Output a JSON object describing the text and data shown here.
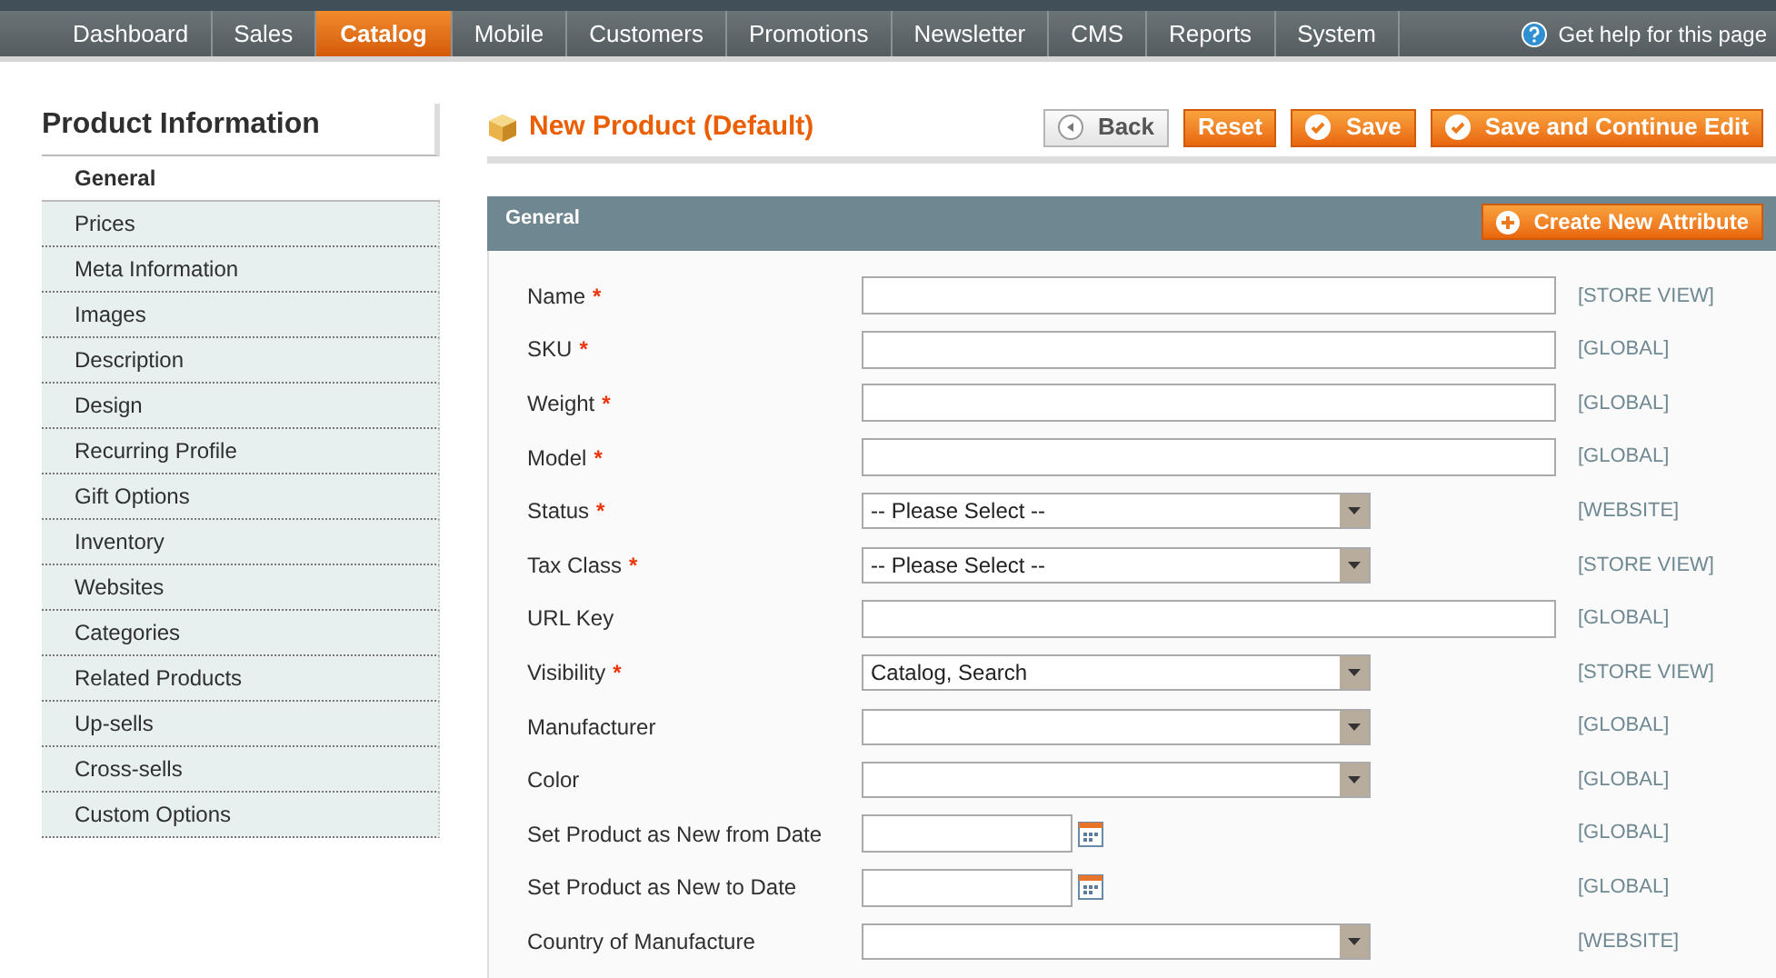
{
  "nav": {
    "tabs": [
      {
        "label": "Dashboard",
        "selected": false
      },
      {
        "label": "Sales",
        "selected": false
      },
      {
        "label": "Catalog",
        "selected": true
      },
      {
        "label": "Mobile",
        "selected": false
      },
      {
        "label": "Customers",
        "selected": false
      },
      {
        "label": "Promotions",
        "selected": false
      },
      {
        "label": "Newsletter",
        "selected": false
      },
      {
        "label": "CMS",
        "selected": false
      },
      {
        "label": "Reports",
        "selected": false
      },
      {
        "label": "System",
        "selected": false
      }
    ],
    "help": "Get help for this page"
  },
  "sidebar": {
    "title": "Product Information",
    "items": [
      {
        "label": "General",
        "selected": true
      },
      {
        "label": "Prices",
        "selected": false
      },
      {
        "label": "Meta Information",
        "selected": false
      },
      {
        "label": "Images",
        "selected": false
      },
      {
        "label": "Description",
        "selected": false
      },
      {
        "label": "Design",
        "selected": false
      },
      {
        "label": "Recurring Profile",
        "selected": false
      },
      {
        "label": "Gift Options",
        "selected": false
      },
      {
        "label": "Inventory",
        "selected": false
      },
      {
        "label": "Websites",
        "selected": false
      },
      {
        "label": "Categories",
        "selected": false
      },
      {
        "label": "Related Products",
        "selected": false
      },
      {
        "label": "Up-sells",
        "selected": false
      },
      {
        "label": "Cross-sells",
        "selected": false
      },
      {
        "label": "Custom Options",
        "selected": false
      }
    ]
  },
  "page": {
    "title": "New Product (Default)",
    "buttons": [
      {
        "label": "Back",
        "kind": "back"
      },
      {
        "label": "Reset",
        "kind": "plain"
      },
      {
        "label": "Save",
        "kind": "check"
      },
      {
        "label": "Save and Continue Edit",
        "kind": "check"
      }
    ]
  },
  "section": {
    "title": "General",
    "action": "Create New Attribute",
    "fields": [
      {
        "label": "Name",
        "mark": "*",
        "kind": "text",
        "scope": "[STORE VIEW]"
      },
      {
        "label": "SKU",
        "mark": "*",
        "kind": "text",
        "scope": "[GLOBAL]"
      },
      {
        "label": "Weight",
        "mark": "*",
        "kind": "text",
        "scope": "[GLOBAL]"
      },
      {
        "label": "Model",
        "mark": "*",
        "kind": "text",
        "scope": "[GLOBAL]"
      },
      {
        "label": "Status",
        "mark": "*",
        "kind": "select",
        "value": "-- Please Select --",
        "scope": "[WEBSITE]"
      },
      {
        "label": "Tax Class",
        "mark": "*",
        "kind": "select",
        "value": "-- Please Select --",
        "scope": "[STORE VIEW]"
      },
      {
        "label": "URL Key",
        "kind": "text",
        "scope": "[GLOBAL]"
      },
      {
        "label": "Visibility",
        "mark": "*",
        "kind": "select",
        "value": "Catalog, Search",
        "scope": "[STORE VIEW]"
      },
      {
        "label": "Manufacturer",
        "kind": "select",
        "scope": "[GLOBAL]"
      },
      {
        "label": "Color",
        "kind": "select",
        "scope": "[GLOBAL]"
      },
      {
        "label": "Set Product as New from Date",
        "kind": "date",
        "scope": "[GLOBAL]"
      },
      {
        "label": "Set Product as New to Date",
        "kind": "date",
        "scope": "[GLOBAL]"
      },
      {
        "label": "Country of Manufacture",
        "kind": "select",
        "scope": "[WEBSITE]"
      }
    ]
  }
}
